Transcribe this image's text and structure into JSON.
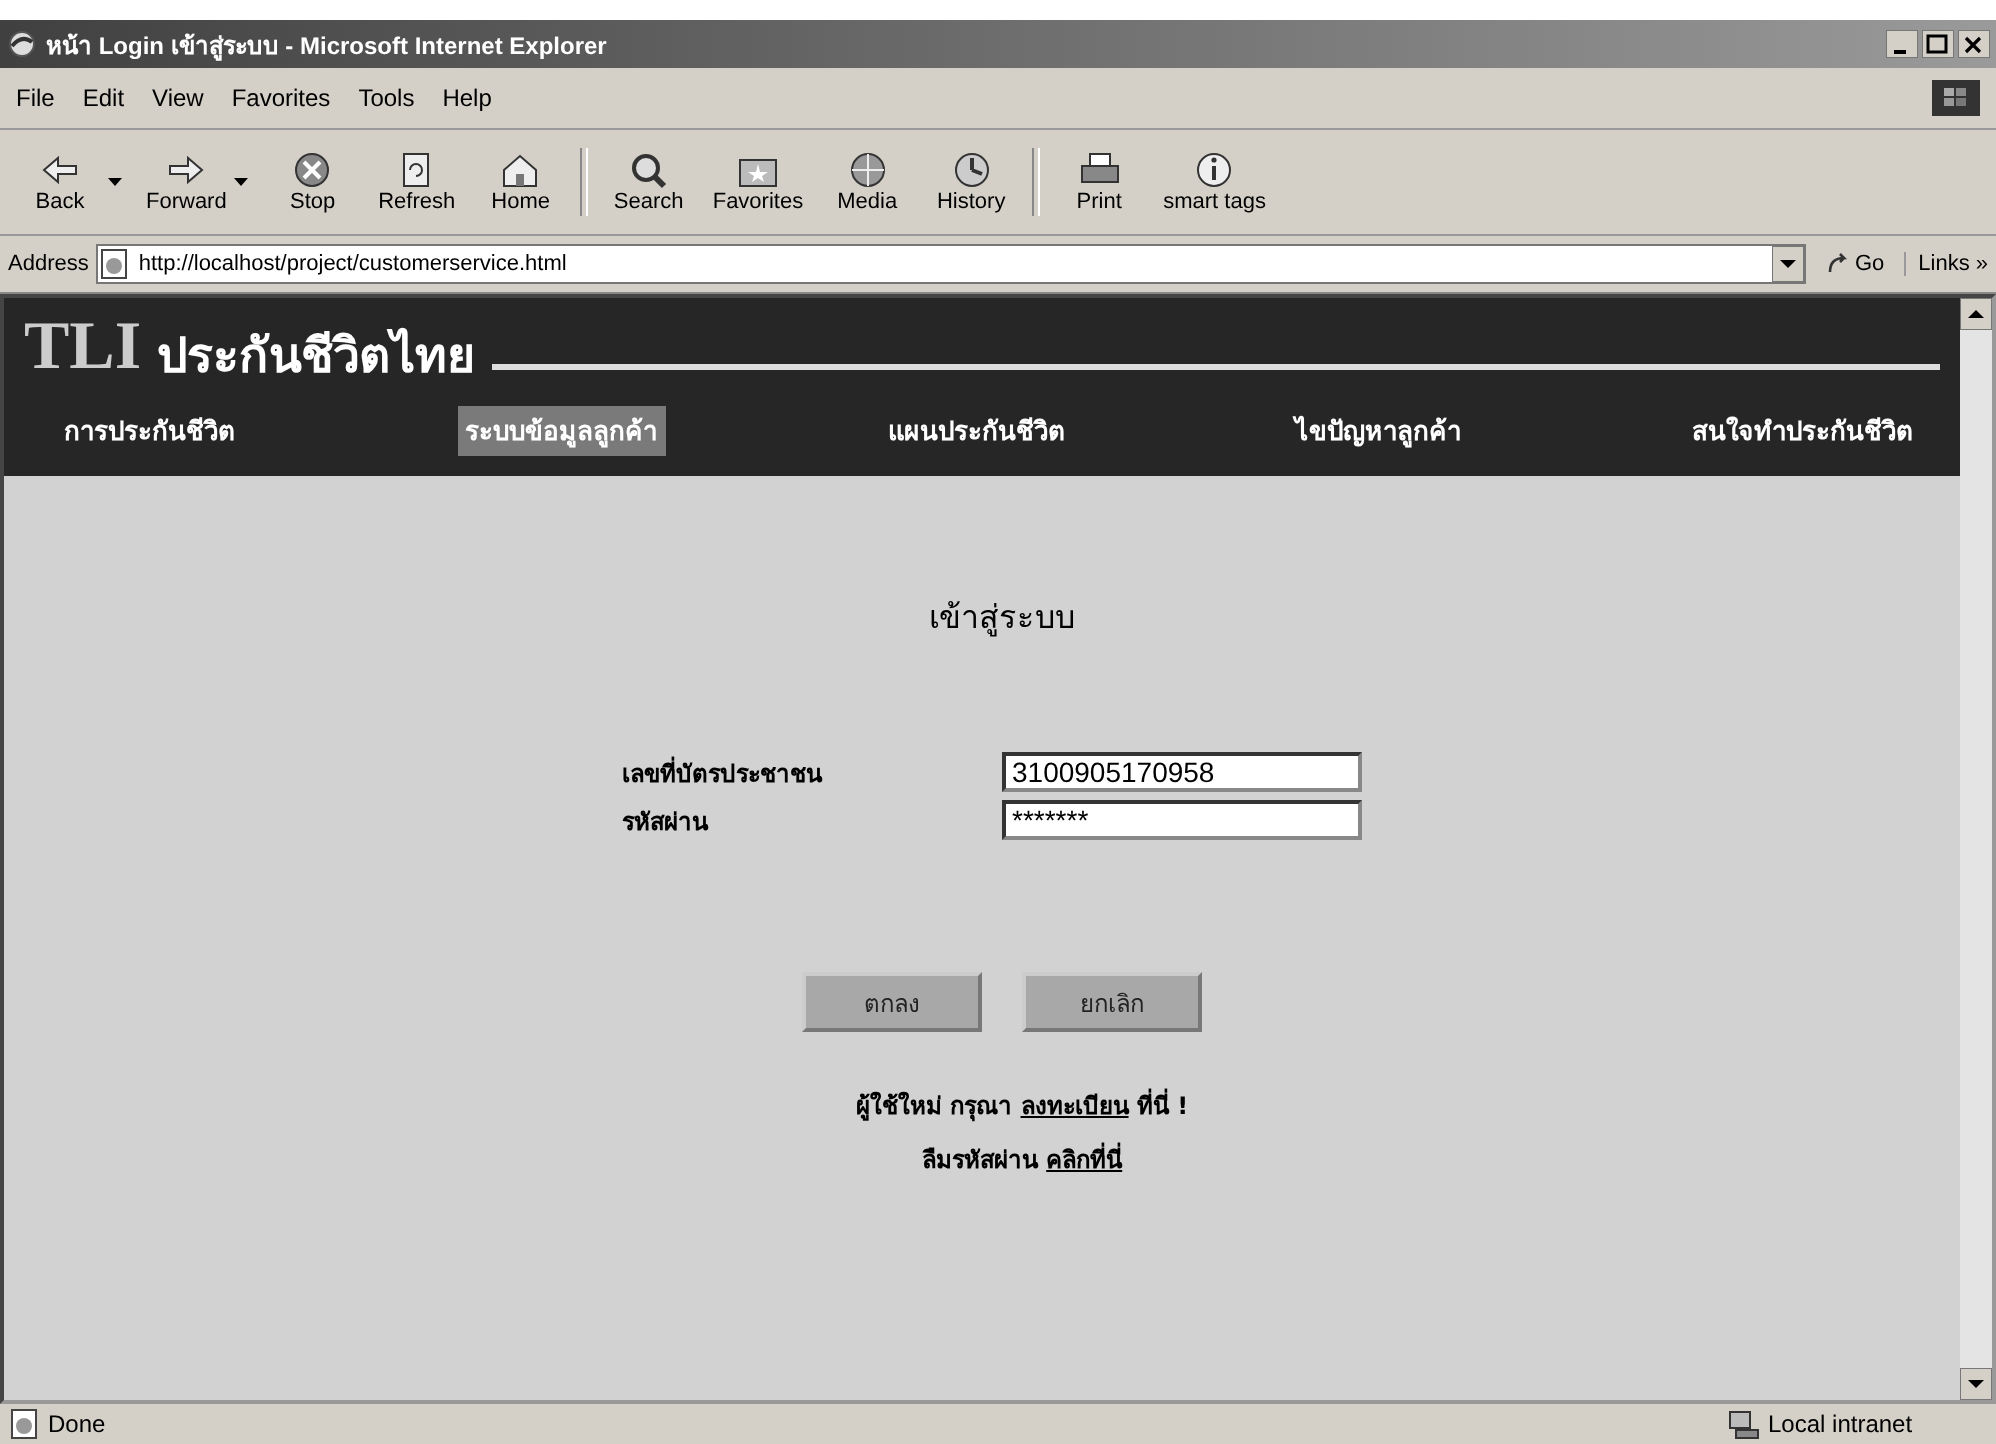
{
  "window": {
    "title": "หน้า Login เข้าสู่ระบบ - Microsoft Internet Explorer"
  },
  "menu": [
    "File",
    "Edit",
    "View",
    "Favorites",
    "Tools",
    "Help"
  ],
  "toolbar": [
    [
      {
        "label": "Back",
        "dropdown": true
      },
      {
        "label": "Forward",
        "dropdown": true
      },
      {
        "label": "Stop",
        "dropdown": false
      },
      {
        "label": "Refresh",
        "dropdown": false
      },
      {
        "label": "Home",
        "dropdown": false
      }
    ],
    [
      {
        "label": "Search",
        "dropdown": false
      },
      {
        "label": "Favorites",
        "dropdown": false
      },
      {
        "label": "Media",
        "dropdown": false
      },
      {
        "label": "History",
        "dropdown": false
      }
    ],
    [
      {
        "label": "Print",
        "dropdown": false
      },
      {
        "label": "smart tags",
        "dropdown": false
      }
    ]
  ],
  "address_bar": {
    "label": "Address",
    "url": "http://localhost/project/customerservice.html",
    "go": "Go",
    "links": "Links »"
  },
  "page": {
    "logo": {
      "mark": "TLI",
      "name": "ประกันชีวิตไทย"
    },
    "nav": [
      {
        "label": "การประกันชีวิต",
        "selected": false
      },
      {
        "label": "ระบบข้อมูลลูกค้า",
        "selected": true
      },
      {
        "label": "แผนประกันชีวิต",
        "selected": false
      },
      {
        "label": "ไขปัญหาลูกค้า",
        "selected": false
      },
      {
        "label": "สนใจทำประกันชีวิต",
        "selected": false
      }
    ],
    "heading": "เข้าสู่ระบบ",
    "fields": [
      {
        "label": "เลขที่บัตรประชาชน",
        "value": "3100905170958"
      },
      {
        "label": "รหัสผ่าน",
        "value": "*******"
      }
    ],
    "buttons": [
      "ตกลง",
      "ยกเลิก"
    ],
    "links": [
      {
        "before": "ผู้ใช้ใหม่ กรุณา",
        "link": "ลงทะเบียน",
        "after": "ที่นี่ !"
      },
      {
        "before": "ลืมรหัสผ่าน",
        "link": "คลิกที่นี่"
      }
    ]
  },
  "status_bar": {
    "text": "Done",
    "zone": "Local intranet"
  }
}
